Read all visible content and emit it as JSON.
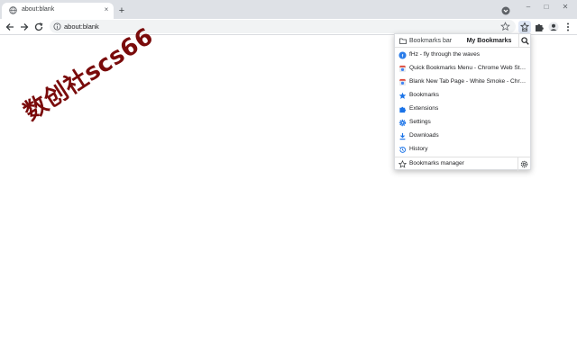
{
  "tab": {
    "title": "about:blank",
    "close_glyph": "×"
  },
  "newtab_glyph": "+",
  "window_controls": {
    "minimize": "–",
    "maximize": "□",
    "close": "✕"
  },
  "omnibox": {
    "url": "about:blank"
  },
  "watermark": "数创社scs66",
  "popup": {
    "tabs": {
      "bookmarks_bar": "Bookmarks bar",
      "my_bookmarks": "My Bookmarks"
    },
    "items": [
      {
        "label": "fHz - fly through the waves",
        "icon": "fhz-favicon"
      },
      {
        "label": "Quick Bookmarks Menu - Chrome Web Store",
        "icon": "chrome-web-store-icon"
      },
      {
        "label": "Blank New Tab Page - White Smoke - Chrome Web Store",
        "icon": "chrome-web-store-icon"
      },
      {
        "label": "Bookmarks",
        "icon": "star-icon"
      },
      {
        "label": "Extensions",
        "icon": "puzzle-icon"
      },
      {
        "label": "Settings",
        "icon": "gear-icon"
      },
      {
        "label": "Downloads",
        "icon": "download-icon"
      },
      {
        "label": "History",
        "icon": "history-icon"
      }
    ],
    "footer": {
      "label": "Bookmarks manager",
      "icon": "star-outline-icon"
    }
  },
  "colors": {
    "accent": "#1a73e8",
    "watermark": "#7a0b0b",
    "tabstrip": "#dee1e6"
  }
}
